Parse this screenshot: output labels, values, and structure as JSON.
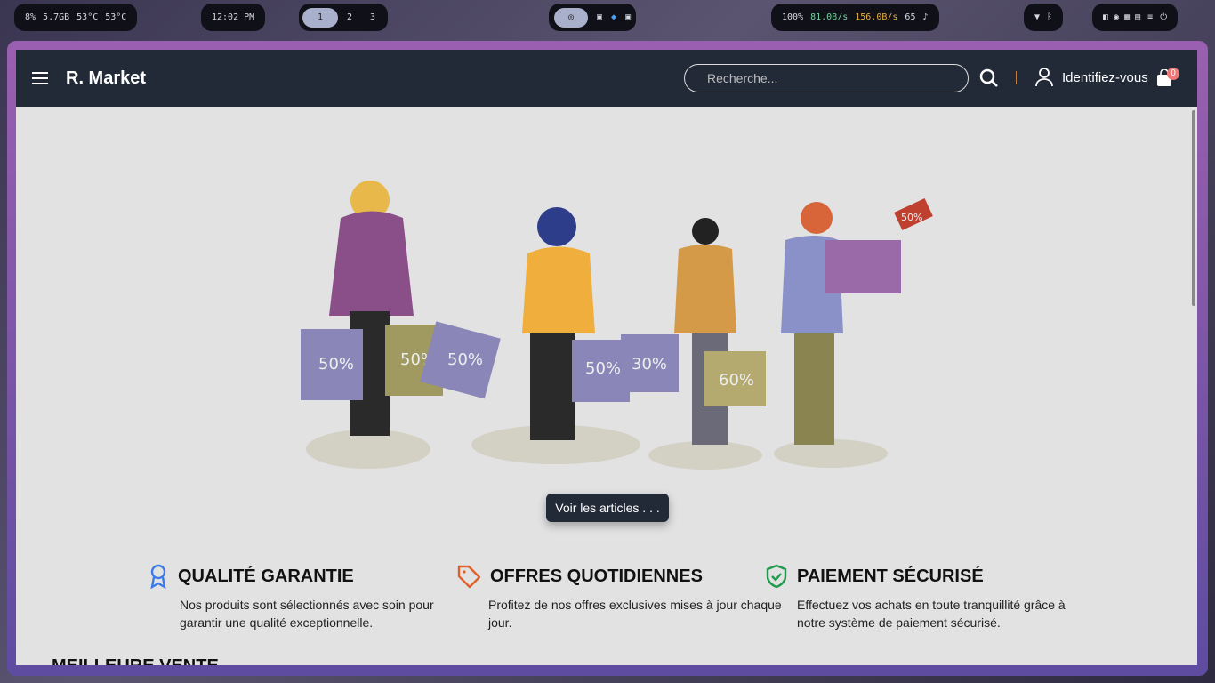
{
  "taskbar": {
    "cpu": "8%",
    "mem": "5.7GB",
    "temp1": "53°C",
    "temp2": "53°C",
    "clock": "12:02 PM",
    "workspaces": [
      "1",
      "2",
      "3"
    ],
    "active_workspace": "1",
    "battery": "100%",
    "download": "81.0B/s",
    "upload": "156.0B/s",
    "volume": "65"
  },
  "header": {
    "brand": "R. Market",
    "search_placeholder": "Recherche...",
    "login": "Identifiez-vous",
    "cart_count": "0"
  },
  "hero": {
    "cta": "Voir les articles . . .",
    "bag_labels": [
      "50%",
      "50%",
      "50%",
      "50%",
      "30%",
      "60%",
      "50%"
    ]
  },
  "features": [
    {
      "title": "QUALITÉ GARANTIE",
      "text": "Nos produits sont sélectionnés avec soin pour garantir une qualité exceptionnelle.",
      "icon": "award-icon",
      "color": "#3b7be8"
    },
    {
      "title": "OFFRES QUOTIDIENNES",
      "text": "Profitez de nos offres exclusives mises à jour chaque jour.",
      "icon": "tag-icon",
      "color": "#e0602a"
    },
    {
      "title": "PAIEMENT SÉCURISÉ",
      "text": "Effectuez vos achats en toute tranquillité grâce à notre système de paiement sécurisé.",
      "icon": "shield-check-icon",
      "color": "#1e9a4a"
    }
  ],
  "section_title": "MEILLEURE VENTE"
}
